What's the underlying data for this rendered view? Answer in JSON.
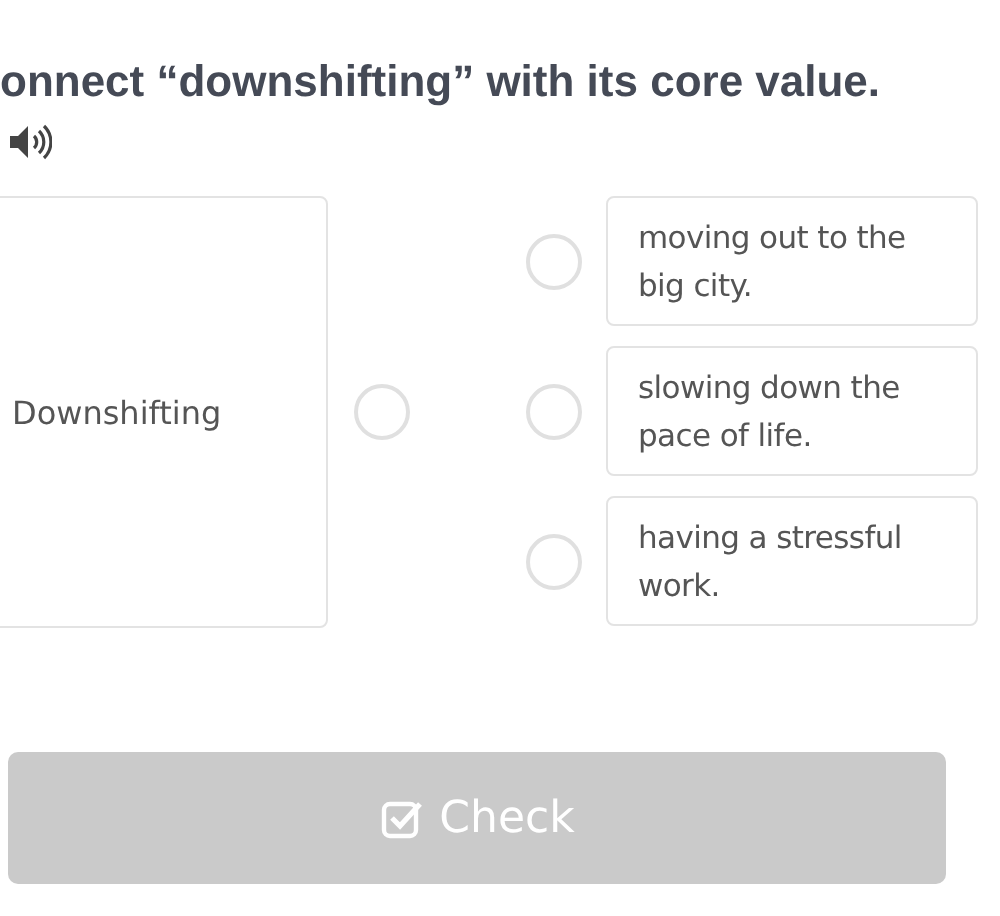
{
  "question": {
    "title": "onnect “downshifting” with its core value."
  },
  "left_items": [
    {
      "text": "Downshifting"
    }
  ],
  "right_items": [
    {
      "text": "moving out to the big city."
    },
    {
      "text": "slowing down the pace of life."
    },
    {
      "text": "having a stressful work."
    }
  ],
  "check_button": {
    "label": "Check",
    "disabled": true
  }
}
